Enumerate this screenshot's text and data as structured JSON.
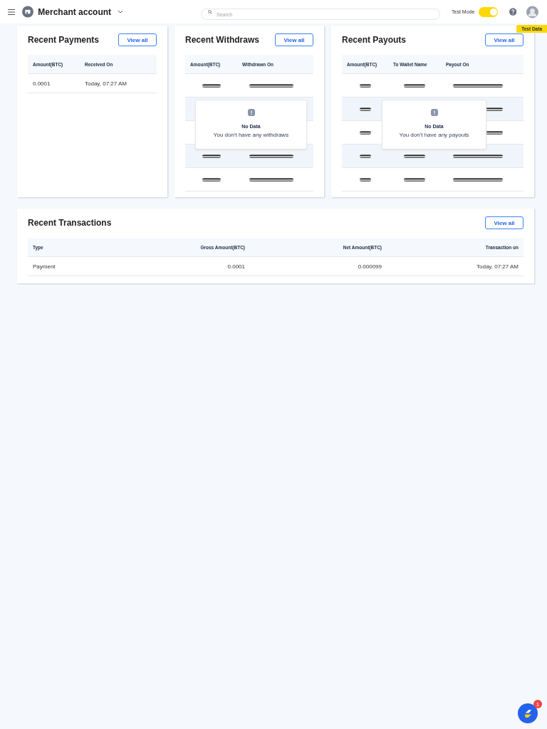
{
  "header": {
    "account": "Merchant account",
    "search": {
      "placeholder": "Search"
    },
    "test_mode": {
      "label": "Test Mode",
      "on": true
    },
    "test_badge": "Test Data"
  },
  "cards": [
    {
      "title": "Recent Payments",
      "button": "View all",
      "columns": [
        "Amount(BTC)",
        "Received On"
      ],
      "rows": [
        [
          "0.0001",
          "Today, 07:27 AM"
        ]
      ]
    },
    {
      "title": "Recent Withdraws",
      "button": "View all",
      "columns": [
        "Amount(BTC)",
        "Withdrawn On"
      ],
      "placeholder_rows": [
        {
          "highlighted": false
        },
        {
          "highlighted": true
        },
        {
          "highlighted": false
        },
        {
          "highlighted": true
        },
        {
          "highlighted": false
        }
      ],
      "empty": {
        "title": "No Data",
        "message": "You don't have any withdraws"
      }
    },
    {
      "title": "Recent Payouts",
      "button": "View all",
      "columns": [
        "Amount(BTC)",
        "To Wallet Name",
        "Payout On"
      ],
      "placeholder_rows": [
        {
          "highlighted": false
        },
        {
          "highlighted": true
        },
        {
          "highlighted": false
        },
        {
          "highlighted": true
        },
        {
          "highlighted": false
        }
      ],
      "empty": {
        "title": "No Data",
        "message": "You don't have any payouts"
      }
    }
  ],
  "transactions": {
    "title": "Recent Transactions",
    "button": "View all",
    "columns": [
      "Type",
      "Gross Amount(BTC)",
      "Net Amount(BTC)",
      "Transaction on"
    ],
    "rows": [
      [
        "Payment",
        "0.0001",
        "0.000099",
        "Today, 07:27 AM"
      ]
    ]
  },
  "chat": {
    "badge": "1"
  }
}
